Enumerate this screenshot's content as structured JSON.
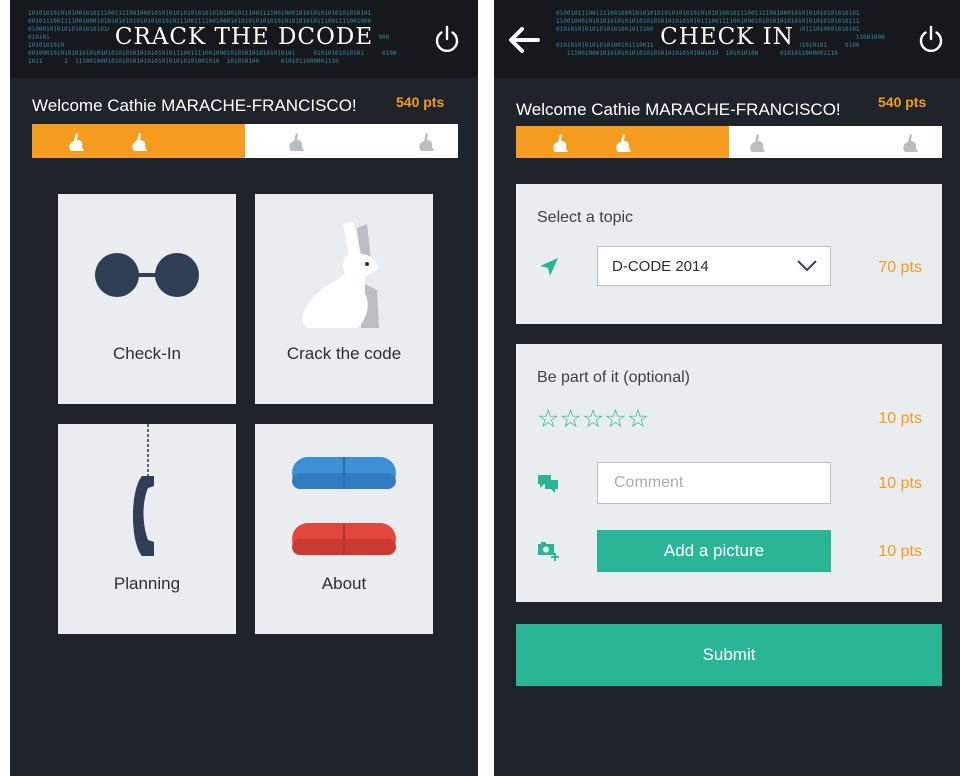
{
  "home": {
    "title": "CRACK THE DCODE",
    "welcome": "Welcome Cathie MARACHE-FRANCISCO!",
    "points": "540 pts",
    "progress_fraction": 0.5,
    "tiles": [
      {
        "label": "Check-In",
        "icon": "glasses-icon"
      },
      {
        "label": "Crack the code",
        "icon": "rabbit-icon"
      },
      {
        "label": "Planning",
        "icon": "phone-receiver-icon"
      },
      {
        "label": "About",
        "icon": "pills-icon"
      }
    ]
  },
  "checkin": {
    "title": "CHECK IN",
    "welcome": "Welcome Cathie MARACHE-FRANCISCO!",
    "points": "540 pts",
    "progress_fraction": 0.5,
    "topic": {
      "heading": "Select a topic",
      "selected": "D-CODE 2014",
      "points": "70 pts"
    },
    "participate": {
      "heading": "Be part of it (optional)",
      "star_count": 5,
      "stars_points": "10 pts",
      "comment_placeholder": "Comment",
      "comment_points": "10 pts",
      "add_picture_label": "Add a picture",
      "picture_points": "10 pts"
    },
    "submit_label": "Submit"
  },
  "binary_lines_left": [
    "10101010101010010101110011110010001010101010101010101010010111001111001000101010101010101010101",
    "00101110011110010001010101010101010101010111001111001000101010101010101010101010111001111001000",
    "01000101010101010101010101010101011100111100100010101010101010101010101010101010111000101010101",
    "010101                                                                                      11001000",
    "1010101010",
    "00100010101010101010101010101010101010101110011110010001010101010101010101     01010101010101     0100",
    "1011      1  1110010001010101010101010101010101001010  101010100      0101011000001110"
  ],
  "binary_lines_right": [
    "010010111001111001000101010101010101010101010100101110011110010001010101010101010101",
    "110010001010101010101010101010101010101011100111100100010101010101010101010101010111",
    "010101010101010101001011100111100100010101010101010101011110010001010111010001010101",
    "                                                                                   11001000",
    "010101010101010100101110011110010001010101010101010101     0101010101010101     0100",
    "   111001000101010101010101010101010101001010  101010100      0101011000001110"
  ]
}
